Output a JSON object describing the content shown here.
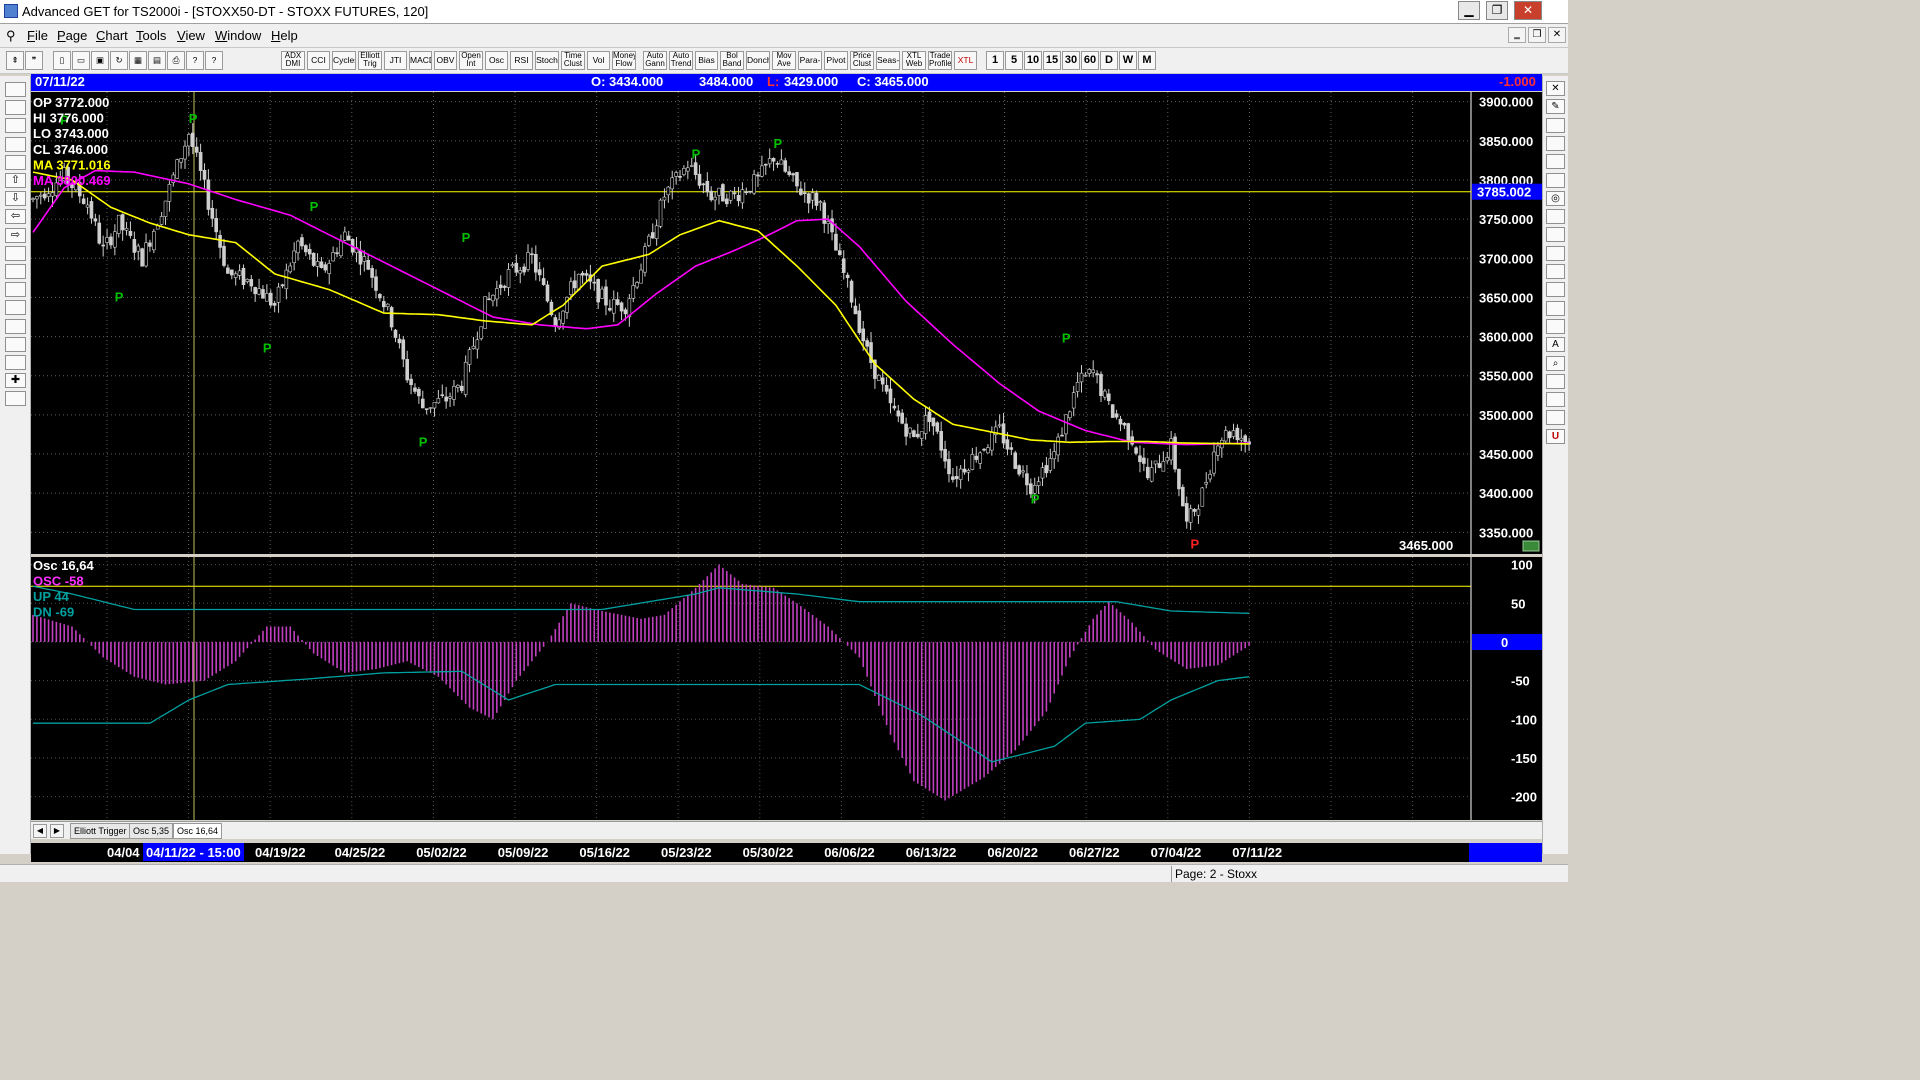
{
  "window": {
    "title": "Advanced GET for TS2000i - [STOXX50-DT - STOXX FUTURES, 120]",
    "minimize": "▁",
    "maximize": "❐",
    "close": "✕"
  },
  "menu": [
    "File",
    "Page",
    "Chart",
    "Tools",
    "View",
    "Window",
    "Help"
  ],
  "mdi_controls": [
    "‗",
    "❐",
    "✕"
  ],
  "toolbar": {
    "left_icons": [
      "pointer-icon",
      "quote-icon",
      "new-page-icon",
      "open-page-icon",
      "save-page-icon",
      "refresh-icon",
      "grid-icon",
      "layout-icon",
      "print-icon",
      "help-icon",
      "whats-this-icon"
    ],
    "studies": [
      "ADX DMI",
      "CCI",
      "Cycles",
      "Elliott Trig",
      "JTI",
      "MACD",
      "OBV",
      "Open Int",
      "Osc",
      "RSI",
      "Stoch",
      "Time Clust",
      "Vol",
      "Money Flow",
      "Auto Gann",
      "Auto Trend",
      "Bias",
      "Bol Band",
      "Donch",
      "Mov Ave",
      "Para-bolic",
      "Pivot",
      "Price Clust",
      "Seas-onals",
      "XTL Web",
      "Trade Profile",
      "XTL"
    ],
    "intervals": [
      "1",
      "5",
      "10",
      "15",
      "30",
      "60",
      "D",
      "W",
      "M"
    ]
  },
  "infobar": {
    "date": "07/11/22",
    "open": "O: 3434.000",
    "high": "3484.000",
    "low_label": "L:",
    "low": "3429.000",
    "close": "C: 3465.000",
    "change": "-1.000"
  },
  "legend": {
    "op": "OP  3772.000",
    "hi": "HI   3776.000",
    "lo": "LO  3743.000",
    "cl": "CL  3746.000",
    "ma1": "MA  3771.016",
    "ma2": "MA  3800.469"
  },
  "price_axis": {
    "labels": [
      "3900.000",
      "3850.000",
      "3800.000",
      "3750.000",
      "3700.000",
      "3650.000",
      "3600.000",
      "3550.000",
      "3500.000",
      "3450.000",
      "3400.000",
      "3350.000"
    ],
    "hline_value": "3785.002",
    "last_close": "3465.000"
  },
  "osc_legend": {
    "title": "Osc 16,64",
    "osc": "OSC -58",
    "up": "UP   44",
    "dn": "DN  -69"
  },
  "osc_axis": {
    "labels": [
      "100",
      "50",
      "0",
      "-50",
      "-100",
      "-150",
      "-200"
    ]
  },
  "tabs": [
    "Elliott Trigger",
    "Osc 5,35",
    "Osc 16,64"
  ],
  "dates": {
    "first": "04/04",
    "cursor": "04/11/22 - 15:00",
    "list": [
      "04/19/22",
      "04/25/22",
      "05/02/22",
      "05/09/22",
      "05/16/22",
      "05/23/22",
      "05/30/22",
      "06/06/22",
      "06/13/22",
      "06/20/22",
      "06/27/22",
      "07/04/22",
      "07/11/22"
    ]
  },
  "status": {
    "page": "Page: 2 - Stoxx"
  },
  "chart_data": {
    "type": "candlestick",
    "symbol": "STOXX50-DT - STOXX FUTURES, 120",
    "ylim": [
      3330,
      3920
    ],
    "anchors": [
      {
        "i": 0,
        "p": 3775
      },
      {
        "i": 8,
        "p": 3805
      },
      {
        "i": 14,
        "p": 3770
      },
      {
        "i": 18,
        "p": 3710
      },
      {
        "i": 22,
        "p": 3745
      },
      {
        "i": 28,
        "p": 3700
      },
      {
        "i": 34,
        "p": 3775
      },
      {
        "i": 40,
        "p": 3860
      },
      {
        "i": 44,
        "p": 3790
      },
      {
        "i": 50,
        "p": 3680
      },
      {
        "i": 56,
        "p": 3670
      },
      {
        "i": 62,
        "p": 3640
      },
      {
        "i": 68,
        "p": 3720
      },
      {
        "i": 74,
        "p": 3680
      },
      {
        "i": 80,
        "p": 3730
      },
      {
        "i": 86,
        "p": 3690
      },
      {
        "i": 92,
        "p": 3620
      },
      {
        "i": 96,
        "p": 3550
      },
      {
        "i": 100,
        "p": 3510
      },
      {
        "i": 106,
        "p": 3520
      },
      {
        "i": 110,
        "p": 3540
      },
      {
        "i": 116,
        "p": 3640
      },
      {
        "i": 122,
        "p": 3680
      },
      {
        "i": 128,
        "p": 3700
      },
      {
        "i": 134,
        "p": 3620
      },
      {
        "i": 140,
        "p": 3680
      },
      {
        "i": 148,
        "p": 3640
      },
      {
        "i": 152,
        "p": 3640
      },
      {
        "i": 156,
        "p": 3690
      },
      {
        "i": 162,
        "p": 3780
      },
      {
        "i": 168,
        "p": 3820
      },
      {
        "i": 174,
        "p": 3780
      },
      {
        "i": 180,
        "p": 3780
      },
      {
        "i": 186,
        "p": 3800
      },
      {
        "i": 190,
        "p": 3830
      },
      {
        "i": 196,
        "p": 3790
      },
      {
        "i": 202,
        "p": 3770
      },
      {
        "i": 206,
        "p": 3710
      },
      {
        "i": 210,
        "p": 3650
      },
      {
        "i": 214,
        "p": 3580
      },
      {
        "i": 220,
        "p": 3510
      },
      {
        "i": 226,
        "p": 3470
      },
      {
        "i": 230,
        "p": 3500
      },
      {
        "i": 236,
        "p": 3420
      },
      {
        "i": 242,
        "p": 3450
      },
      {
        "i": 248,
        "p": 3480
      },
      {
        "i": 252,
        "p": 3440
      },
      {
        "i": 256,
        "p": 3410
      },
      {
        "i": 262,
        "p": 3450
      },
      {
        "i": 268,
        "p": 3540
      },
      {
        "i": 272,
        "p": 3555
      },
      {
        "i": 276,
        "p": 3510
      },
      {
        "i": 282,
        "p": 3470
      },
      {
        "i": 286,
        "p": 3420
      },
      {
        "i": 292,
        "p": 3460
      },
      {
        "i": 296,
        "p": 3360
      },
      {
        "i": 300,
        "p": 3400
      },
      {
        "i": 304,
        "p": 3470
      },
      {
        "i": 308,
        "p": 3480
      },
      {
        "i": 312,
        "p": 3465
      }
    ],
    "ma_fast_anchors": [
      {
        "i": 0,
        "p": 3810
      },
      {
        "i": 10,
        "p": 3800
      },
      {
        "i": 20,
        "p": 3765
      },
      {
        "i": 30,
        "p": 3745
      },
      {
        "i": 40,
        "p": 3730
      },
      {
        "i": 52,
        "p": 3720
      },
      {
        "i": 62,
        "p": 3680
      },
      {
        "i": 76,
        "p": 3660
      },
      {
        "i": 90,
        "p": 3630
      },
      {
        "i": 104,
        "p": 3628
      },
      {
        "i": 116,
        "p": 3620
      },
      {
        "i": 128,
        "p": 3615
      },
      {
        "i": 136,
        "p": 3640
      },
      {
        "i": 146,
        "p": 3690
      },
      {
        "i": 158,
        "p": 3705
      },
      {
        "i": 166,
        "p": 3730
      },
      {
        "i": 176,
        "p": 3748
      },
      {
        "i": 186,
        "p": 3735
      },
      {
        "i": 196,
        "p": 3690
      },
      {
        "i": 206,
        "p": 3640
      },
      {
        "i": 216,
        "p": 3565
      },
      {
        "i": 226,
        "p": 3520
      },
      {
        "i": 236,
        "p": 3488
      },
      {
        "i": 246,
        "p": 3478
      },
      {
        "i": 256,
        "p": 3468
      },
      {
        "i": 266,
        "p": 3465
      },
      {
        "i": 276,
        "p": 3466
      },
      {
        "i": 286,
        "p": 3466
      },
      {
        "i": 296,
        "p": 3464
      },
      {
        "i": 312,
        "p": 3463
      }
    ],
    "ma_slow_anchors": [
      {
        "i": 0,
        "p": 3733
      },
      {
        "i": 8,
        "p": 3790
      },
      {
        "i": 16,
        "p": 3812
      },
      {
        "i": 26,
        "p": 3810
      },
      {
        "i": 40,
        "p": 3795
      },
      {
        "i": 52,
        "p": 3775
      },
      {
        "i": 66,
        "p": 3755
      },
      {
        "i": 80,
        "p": 3720
      },
      {
        "i": 92,
        "p": 3690
      },
      {
        "i": 106,
        "p": 3655
      },
      {
        "i": 118,
        "p": 3625
      },
      {
        "i": 130,
        "p": 3615
      },
      {
        "i": 142,
        "p": 3610
      },
      {
        "i": 150,
        "p": 3615
      },
      {
        "i": 160,
        "p": 3655
      },
      {
        "i": 170,
        "p": 3690
      },
      {
        "i": 180,
        "p": 3710
      },
      {
        "i": 188,
        "p": 3728
      },
      {
        "i": 196,
        "p": 3748
      },
      {
        "i": 204,
        "p": 3750
      },
      {
        "i": 212,
        "p": 3715
      },
      {
        "i": 224,
        "p": 3645
      },
      {
        "i": 236,
        "p": 3590
      },
      {
        "i": 248,
        "p": 3540
      },
      {
        "i": 258,
        "p": 3505
      },
      {
        "i": 270,
        "p": 3480
      },
      {
        "i": 282,
        "p": 3465
      },
      {
        "i": 296,
        "p": 3462
      },
      {
        "i": 312,
        "p": 3464
      }
    ],
    "hline": 3785.002,
    "pivots": [
      {
        "i": 8,
        "p": 3868,
        "type": "high"
      },
      {
        "i": 22,
        "p": 3660,
        "type": "low"
      },
      {
        "i": 41,
        "p": 3870,
        "type": "high"
      },
      {
        "i": 60,
        "p": 3595,
        "type": "low"
      },
      {
        "i": 72,
        "p": 3758,
        "type": "high"
      },
      {
        "i": 100,
        "p": 3475,
        "type": "low"
      },
      {
        "i": 111,
        "p": 3718,
        "type": "high"
      },
      {
        "i": 170,
        "p": 3825,
        "type": "high"
      },
      {
        "i": 191,
        "p": 3838,
        "type": "high"
      },
      {
        "i": 257,
        "p": 3402,
        "type": "low"
      },
      {
        "i": 265,
        "p": 3590,
        "type": "high"
      },
      {
        "i": 298,
        "p": 3345,
        "type": "low"
      }
    ],
    "bars": 313,
    "osc": {
      "ylim": [
        -225,
        115
      ],
      "anchors": [
        {
          "i": 0,
          "v": 35
        },
        {
          "i": 10,
          "v": 20
        },
        {
          "i": 18,
          "v": -20
        },
        {
          "i": 26,
          "v": -45
        },
        {
          "i": 34,
          "v": -55
        },
        {
          "i": 44,
          "v": -50
        },
        {
          "i": 52,
          "v": -25
        },
        {
          "i": 60,
          "v": 20
        },
        {
          "i": 66,
          "v": 20
        },
        {
          "i": 72,
          "v": -15
        },
        {
          "i": 80,
          "v": -40
        },
        {
          "i": 88,
          "v": -35
        },
        {
          "i": 96,
          "v": -25
        },
        {
          "i": 104,
          "v": -45
        },
        {
          "i": 112,
          "v": -85
        },
        {
          "i": 118,
          "v": -100
        },
        {
          "i": 124,
          "v": -50
        },
        {
          "i": 132,
          "v": 0
        },
        {
          "i": 138,
          "v": 50
        },
        {
          "i": 146,
          "v": 40
        },
        {
          "i": 156,
          "v": 30
        },
        {
          "i": 162,
          "v": 35
        },
        {
          "i": 170,
          "v": 70
        },
        {
          "i": 176,
          "v": 100
        },
        {
          "i": 182,
          "v": 75
        },
        {
          "i": 190,
          "v": 70
        },
        {
          "i": 196,
          "v": 50
        },
        {
          "i": 204,
          "v": 20
        },
        {
          "i": 212,
          "v": -20
        },
        {
          "i": 220,
          "v": -120
        },
        {
          "i": 226,
          "v": -180
        },
        {
          "i": 234,
          "v": -205
        },
        {
          "i": 244,
          "v": -175
        },
        {
          "i": 252,
          "v": -140
        },
        {
          "i": 260,
          "v": -90
        },
        {
          "i": 266,
          "v": -20
        },
        {
          "i": 272,
          "v": 30
        },
        {
          "i": 276,
          "v": 52
        },
        {
          "i": 282,
          "v": 25
        },
        {
          "i": 288,
          "v": -10
        },
        {
          "i": 296,
          "v": -35
        },
        {
          "i": 304,
          "v": -30
        },
        {
          "i": 312,
          "v": -5
        }
      ],
      "up_anchors": [
        {
          "i": 0,
          "v": 72
        },
        {
          "i": 10,
          "v": 62
        },
        {
          "i": 26,
          "v": 42
        },
        {
          "i": 70,
          "v": 42
        },
        {
          "i": 104,
          "v": 42
        },
        {
          "i": 132,
          "v": 42
        },
        {
          "i": 146,
          "v": 42
        },
        {
          "i": 170,
          "v": 62
        },
        {
          "i": 176,
          "v": 70
        },
        {
          "i": 196,
          "v": 62
        },
        {
          "i": 212,
          "v": 52
        },
        {
          "i": 278,
          "v": 52
        },
        {
          "i": 292,
          "v": 40
        },
        {
          "i": 312,
          "v": 37
        }
      ],
      "dn_anchors": [
        {
          "i": 0,
          "v": -105
        },
        {
          "i": 30,
          "v": -105
        },
        {
          "i": 40,
          "v": -75
        },
        {
          "i": 50,
          "v": -55
        },
        {
          "i": 70,
          "v": -48
        },
        {
          "i": 90,
          "v": -40
        },
        {
          "i": 110,
          "v": -38
        },
        {
          "i": 122,
          "v": -75
        },
        {
          "i": 134,
          "v": -55
        },
        {
          "i": 150,
          "v": -55
        },
        {
          "i": 212,
          "v": -55
        },
        {
          "i": 228,
          "v": -95
        },
        {
          "i": 246,
          "v": -155
        },
        {
          "i": 262,
          "v": -135
        },
        {
          "i": 270,
          "v": -105
        },
        {
          "i": 284,
          "v": -100
        },
        {
          "i": 292,
          "v": -75
        },
        {
          "i": 304,
          "v": -50
        },
        {
          "i": 312,
          "v": -45
        }
      ],
      "hline": 72
    },
    "colors": {
      "bar": "#cfcfcf",
      "ma_fast": "#ffff00",
      "ma_slow": "#ff00ff",
      "pivot_high": "#00c000",
      "pivot_low": "#00c000",
      "pivot_last_low": "#ff2020",
      "osc": "#c040c0",
      "band": "#00a0a0",
      "hline": "#ffff00",
      "cursor": "#c0c060"
    }
  }
}
